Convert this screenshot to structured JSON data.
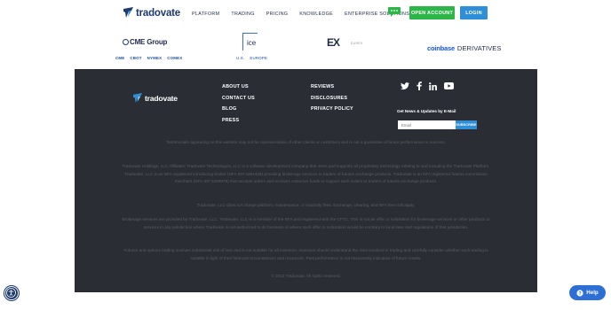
{
  "header": {
    "logo_text": "tradovate",
    "nav": [
      "PLATFORM",
      "TRADING",
      "PRICING",
      "KNOWLEDGE",
      "ENTERPRISE SOLUTIONS"
    ],
    "open_account_label": "OPEN ACCOUNT",
    "login_label": "LOGIN"
  },
  "partners": {
    "cme": {
      "name": "CME Group",
      "sub": [
        "CME",
        "CBOT",
        "NYMEX",
        "COMEX"
      ]
    },
    "ice": {
      "name": "ice",
      "sub": [
        "U.S.",
        "EUROPE"
      ]
    },
    "eex": {
      "name": "EX",
      "sub": "EUREX"
    },
    "coinbase": {
      "brand": "coinbase",
      "suffix": "DERIVATIVES"
    }
  },
  "footer": {
    "logo_text": "tradovate",
    "links_col1": [
      "ABOUT US",
      "CONTACT US",
      "BLOG",
      "PRESS"
    ],
    "links_col2": [
      "REVIEWS",
      "DISCLOSURES",
      "PRIVACY POLICY"
    ],
    "social_icons": [
      "twitter-icon",
      "facebook-icon",
      "linkedin-icon",
      "youtube-icon"
    ],
    "newsletter_label": "Get News & Updates by E-Mail",
    "email_placeholder": "Email",
    "subscribe_label": "SUBSCRIBE",
    "disclaimers": [
      "Testimonials appearing on this website may not be representative of other clients or customers and is not a guarantee of future performance or success.",
      "Tradovate Holdings, LLC Affiliates: Tradovate Technologies, LLC is a software development company that owns and supports all proprietary technology relating to and including the Tradovate Platform. Tradovate, LLC is an NFA registered introducing broker (NFA ID# 0484428) providing brokerage services to traders of futures exchange products. Tradovate is an NFA registered futures commission merchant (NFA ID# 0309979) that accepts orders and receives customer funds to support such orders to traders of futures exchange products.",
      "Tradovate, LLC does not charge platform, maintenance, or inactivity fees. Exchange, clearing, and NFA fees still apply.",
      "Brokerage services are provided by Tradovate, LLC. Tradovate, LLC is a member of the NFA and registered with the CFTC. This is not an offer or solicitation for brokerage services or other products or services in any jurisdiction where Tradovate is not authorized to do business or where such offer or solicitation would be contrary to local laws and regulations of that jurisdiction.",
      "Futures and options trading involves substantial risk of loss and is not suitable for all investors. Investors should understand the risks involved in trading and carefully consider whether such trading is suitable in light of their financial circumstances and resources. Past performance is not necessarily indicative of future results.",
      "© 2022 Tradovate. All rights reserved."
    ]
  },
  "widgets": {
    "help_label": "Help",
    "accessibility_icon": "accessibility-icon"
  },
  "colors": {
    "brand_navy": "#1e3a6e",
    "footer_bg": "#2b2d35",
    "open_account_green": "#2eb54a",
    "login_blue": "#2e8fd6",
    "coinbase_blue": "#1652f0"
  }
}
